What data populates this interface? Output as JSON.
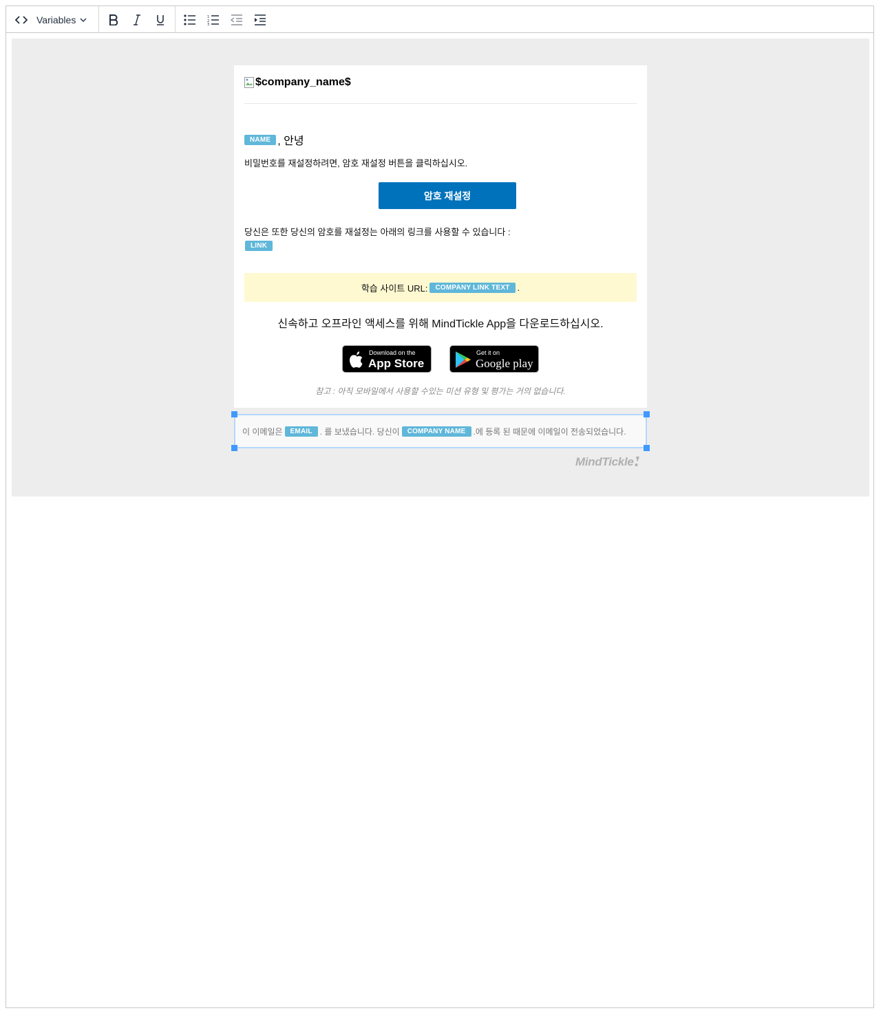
{
  "toolbar": {
    "variables_label": "Variables"
  },
  "email": {
    "logo_alt": "$company_name$",
    "name_tag": "NAME",
    "greeting_suffix": ", 안녕",
    "instruction": "비밀번호를 재설정하려면, 암호 재설정 버튼을 클릭하십시오.",
    "reset_button": "암호 재설정",
    "alt_link_text": "당신은 또한 당신의 암호를 재설정는 아래의 링크를 사용할 수 있습니다 :",
    "link_tag": "LINK",
    "site_url_label": "학습 사이트 URL:",
    "company_link_tag": "COMPANY LINK TEXT",
    "site_url_suffix": ".",
    "download_text": "신속하고 오프라인 액세스를 위해 MindTickle App을 다운로드하십시오.",
    "app_store": {
      "small": "Download on the",
      "big": "App Store"
    },
    "google_play": {
      "small": "Get it on",
      "big": "Google play"
    },
    "note": "참고 : 아직 모바일에서 사용할 수있는 미션 유형 및 평가는 거의 없습니다.",
    "footer": {
      "prefix": "이 이메일은",
      "email_tag": "EMAIL",
      "middle": ". 를 보냈습니다. 당신이",
      "company_tag": "COMPANY NAME",
      "suffix": ".에 등록 된 때문에 이메일이 전송되었습니다."
    },
    "brand": "MindTickle"
  },
  "colors": {
    "canvas_bg": "#ededed",
    "button_blue": "#0072bc",
    "tag_blue": "#5fb7d9",
    "banner_yellow": "#fff9d1",
    "selection_blue": "#4099ff"
  }
}
